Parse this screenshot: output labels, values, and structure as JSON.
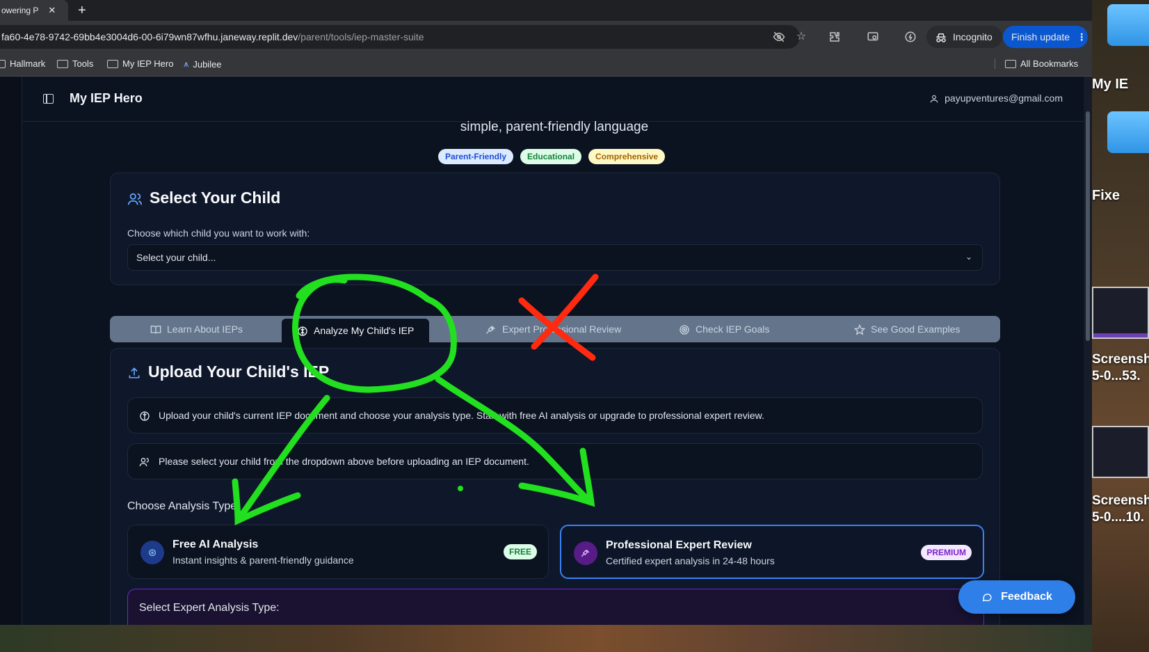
{
  "browser": {
    "tab_title": "owering P",
    "url_host": "fa60-4e78-9742-69bb4e3004d6-00-6i79wn87wfhu.janeway.replit.dev",
    "url_path": "/parent/tools/iep-master-suite",
    "incognito_label": "Incognito",
    "finish_update_label": "Finish update",
    "bookmarks": [
      "Hallmark",
      "Tools",
      "My IEP Hero",
      "Jubilee"
    ],
    "all_bookmarks_label": "All Bookmarks"
  },
  "app": {
    "brand": "My IEP Hero",
    "user_email": "payupventures@gmail.com",
    "subtitle": "simple, parent-friendly language",
    "pills": [
      "Parent-Friendly",
      "Educational",
      "Comprehensive"
    ]
  },
  "child_card": {
    "title": "Select Your Child",
    "label": "Choose which child you want to work with:",
    "select_value": "Select your child..."
  },
  "tabs": [
    {
      "label": "Learn About IEPs",
      "icon": "book-icon"
    },
    {
      "label": "Analyze My Child's IEP",
      "icon": "brain-icon"
    },
    {
      "label": "Expert Professional Review",
      "icon": "gavel-icon"
    },
    {
      "label": "Check IEP Goals",
      "icon": "target-icon"
    },
    {
      "label": "See Good Examples",
      "icon": "star-icon"
    }
  ],
  "upload_card": {
    "title": "Upload Your Child's IEP",
    "info_text": "Upload your child's current IEP document and choose your analysis type. Start with free AI analysis or upgrade to professional expert review.",
    "warning_text": "Please select your child from the dropdown above before uploading an IEP document.",
    "choose_label": "Choose Analysis Type:",
    "options": [
      {
        "title": "Free AI Analysis",
        "desc": "Instant insights & parent-friendly guidance",
        "badge": "FREE"
      },
      {
        "title": "Professional Expert Review",
        "desc": "Certified expert analysis in 24-48 hours",
        "badge": "PREMIUM"
      }
    ],
    "expert_title": "Select Expert Analysis Type:"
  },
  "feedback_label": "Feedback",
  "desktop": {
    "items": [
      "My IE",
      "Fixe"
    ],
    "screenshots": [
      "Screensh\n5-0...53.",
      "Screensh\n5-0....10."
    ]
  },
  "colors": {
    "accent": "#3b82f6",
    "annotation_green": "#22e01f",
    "annotation_red": "#ff2a10"
  }
}
